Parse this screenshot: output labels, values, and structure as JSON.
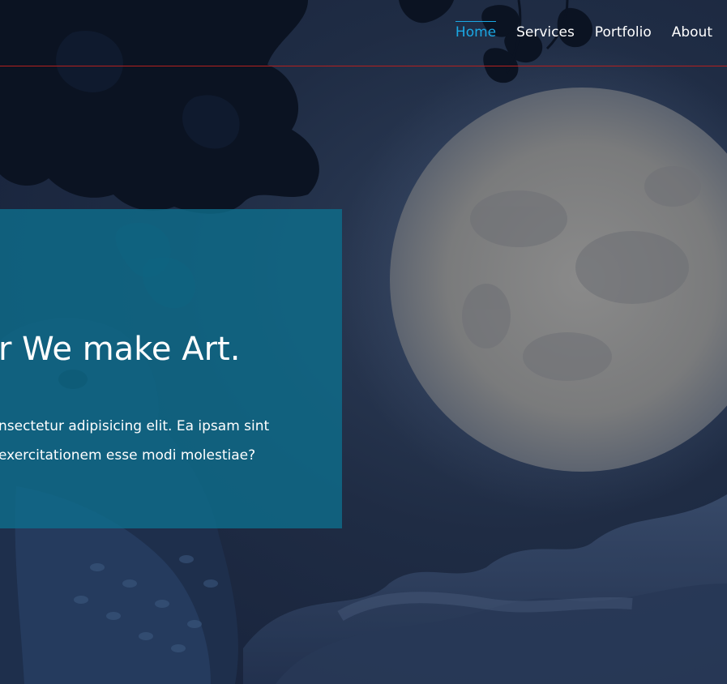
{
  "nav": {
    "items": [
      {
        "label": "Home",
        "active": true
      },
      {
        "label": "Services",
        "active": false
      },
      {
        "label": "Portfolio",
        "active": false
      },
      {
        "label": "About",
        "active": false
      }
    ]
  },
  "hero": {
    "title": "r We make Art.",
    "text_line1": "nsectetur adipisicing elit. Ea ipsam sint",
    "text_line2": "exercitationem esse modi molestiae?"
  },
  "colors": {
    "accent": "#1aa8e4",
    "header_rule": "#b3201f",
    "hero_panel": "#0e6e8c",
    "sky": "#1f2c44"
  }
}
